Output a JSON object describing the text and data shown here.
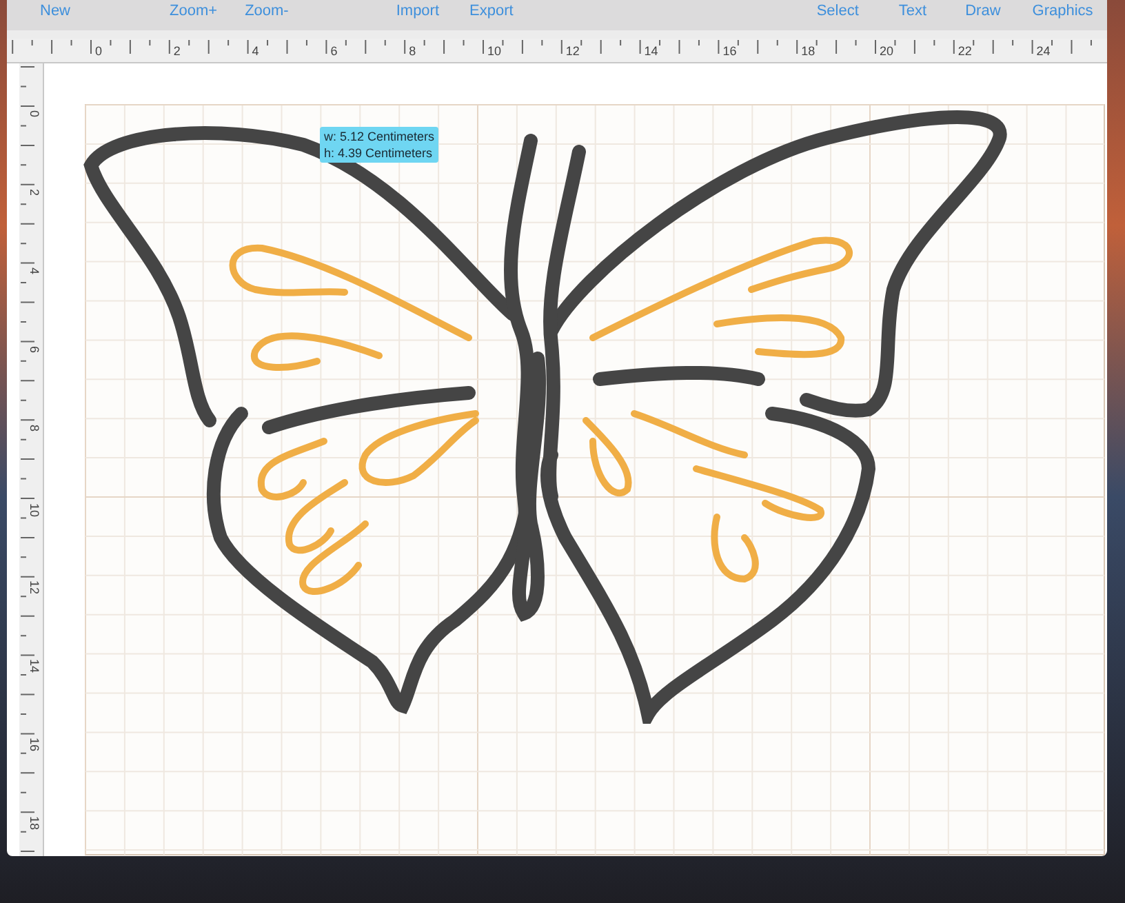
{
  "toolbar": {
    "left": [
      "New",
      "Zoom+",
      "Zoom-",
      "Import",
      "Export"
    ],
    "right": [
      "Select",
      "Text",
      "Draw",
      "Graphics"
    ]
  },
  "horizontal_ruler": {
    "labels": [
      "0",
      "2",
      "4",
      "6",
      "8",
      "10",
      "12",
      "14",
      "16",
      "18",
      "20",
      "22",
      "24"
    ]
  },
  "vertical_ruler": {
    "labels": [
      "0",
      "2",
      "4",
      "6",
      "8",
      "10",
      "12",
      "14",
      "16",
      "18"
    ]
  },
  "tooltip": {
    "lines": [
      "w: 5.12 Centimeters",
      "h: 4.39 Centimeters"
    ]
  }
}
